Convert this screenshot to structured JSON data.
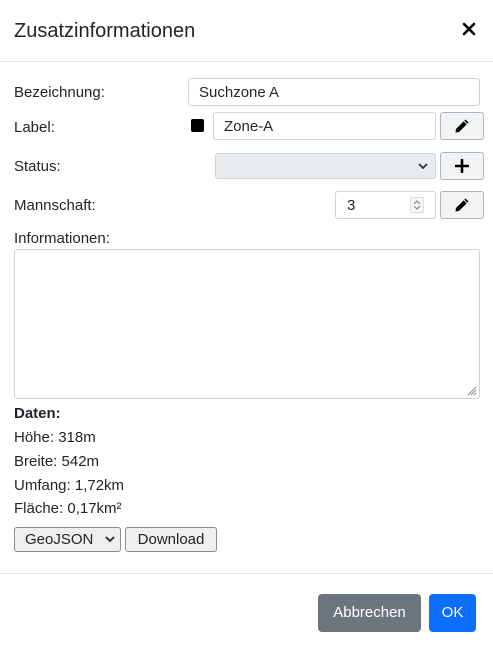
{
  "dialog": {
    "title": "Zusatzinformationen",
    "close_icon": "close-icon"
  },
  "form": {
    "bezeichnung": {
      "label": "Bezeichnung:",
      "value": "Suchzone A"
    },
    "label": {
      "label": "Label:",
      "color": "#000000",
      "value": "Zone-A",
      "edit_icon": "pencil-icon"
    },
    "status": {
      "label": "Status:",
      "value": "",
      "add_icon": "plus-icon"
    },
    "mannschaft": {
      "label": "Mannschaft:",
      "value": "3",
      "edit_icon": "pencil-icon"
    },
    "informationen": {
      "label": "Informationen:",
      "value": ""
    }
  },
  "daten": {
    "title": "Daten:",
    "lines": [
      "Höhe: 318m",
      "Breite: 542m",
      "Umfang: 1,72km",
      "Fläche: 0,17km²"
    ],
    "format_selected": "GeoJSON",
    "download_label": "Download"
  },
  "footer": {
    "cancel_label": "Abbrechen",
    "ok_label": "OK"
  },
  "colors": {
    "primary": "#0d6efd",
    "secondary": "#6c757d",
    "border": "#dee2e6"
  }
}
